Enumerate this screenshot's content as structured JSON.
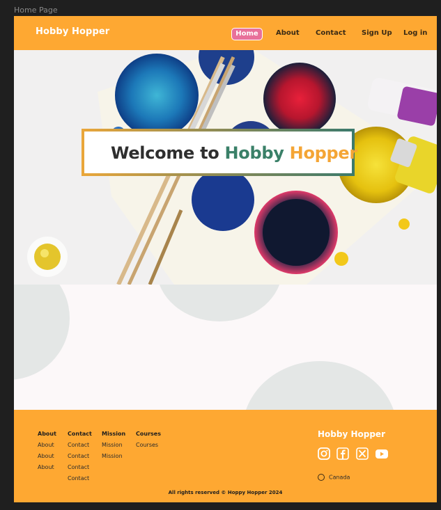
{
  "frame_label": "Home Page",
  "header": {
    "brand": "Hobby Hopper",
    "nav": [
      "Home",
      "About",
      "Contact",
      "Sign Up",
      "Log in"
    ]
  },
  "hero": {
    "welcome_prefix": "Welcome to ",
    "welcome_word1": "Hobby",
    "welcome_space": " ",
    "welcome_word2": "Hopper"
  },
  "footer": {
    "columns": [
      {
        "heading": "About",
        "items": [
          "About",
          "About",
          "About"
        ]
      },
      {
        "heading": "Contact",
        "items": [
          "Contact",
          "Contact",
          "Contact",
          "Contact"
        ]
      },
      {
        "heading": "Mission",
        "items": [
          "Mission",
          "Mission"
        ]
      },
      {
        "heading": "Courses",
        "items": [
          "Courses"
        ]
      }
    ],
    "brand": "Hobby Hopper",
    "socials": [
      "instagram-icon",
      "facebook-icon",
      "x-icon",
      "youtube-icon"
    ],
    "region": "Canada",
    "copyright": "All rights reserved ©  Hoppy Hopper 2024"
  },
  "colors": {
    "primary": "#fea832",
    "home_button": "#e8709a",
    "accent_green": "#3a8068"
  }
}
